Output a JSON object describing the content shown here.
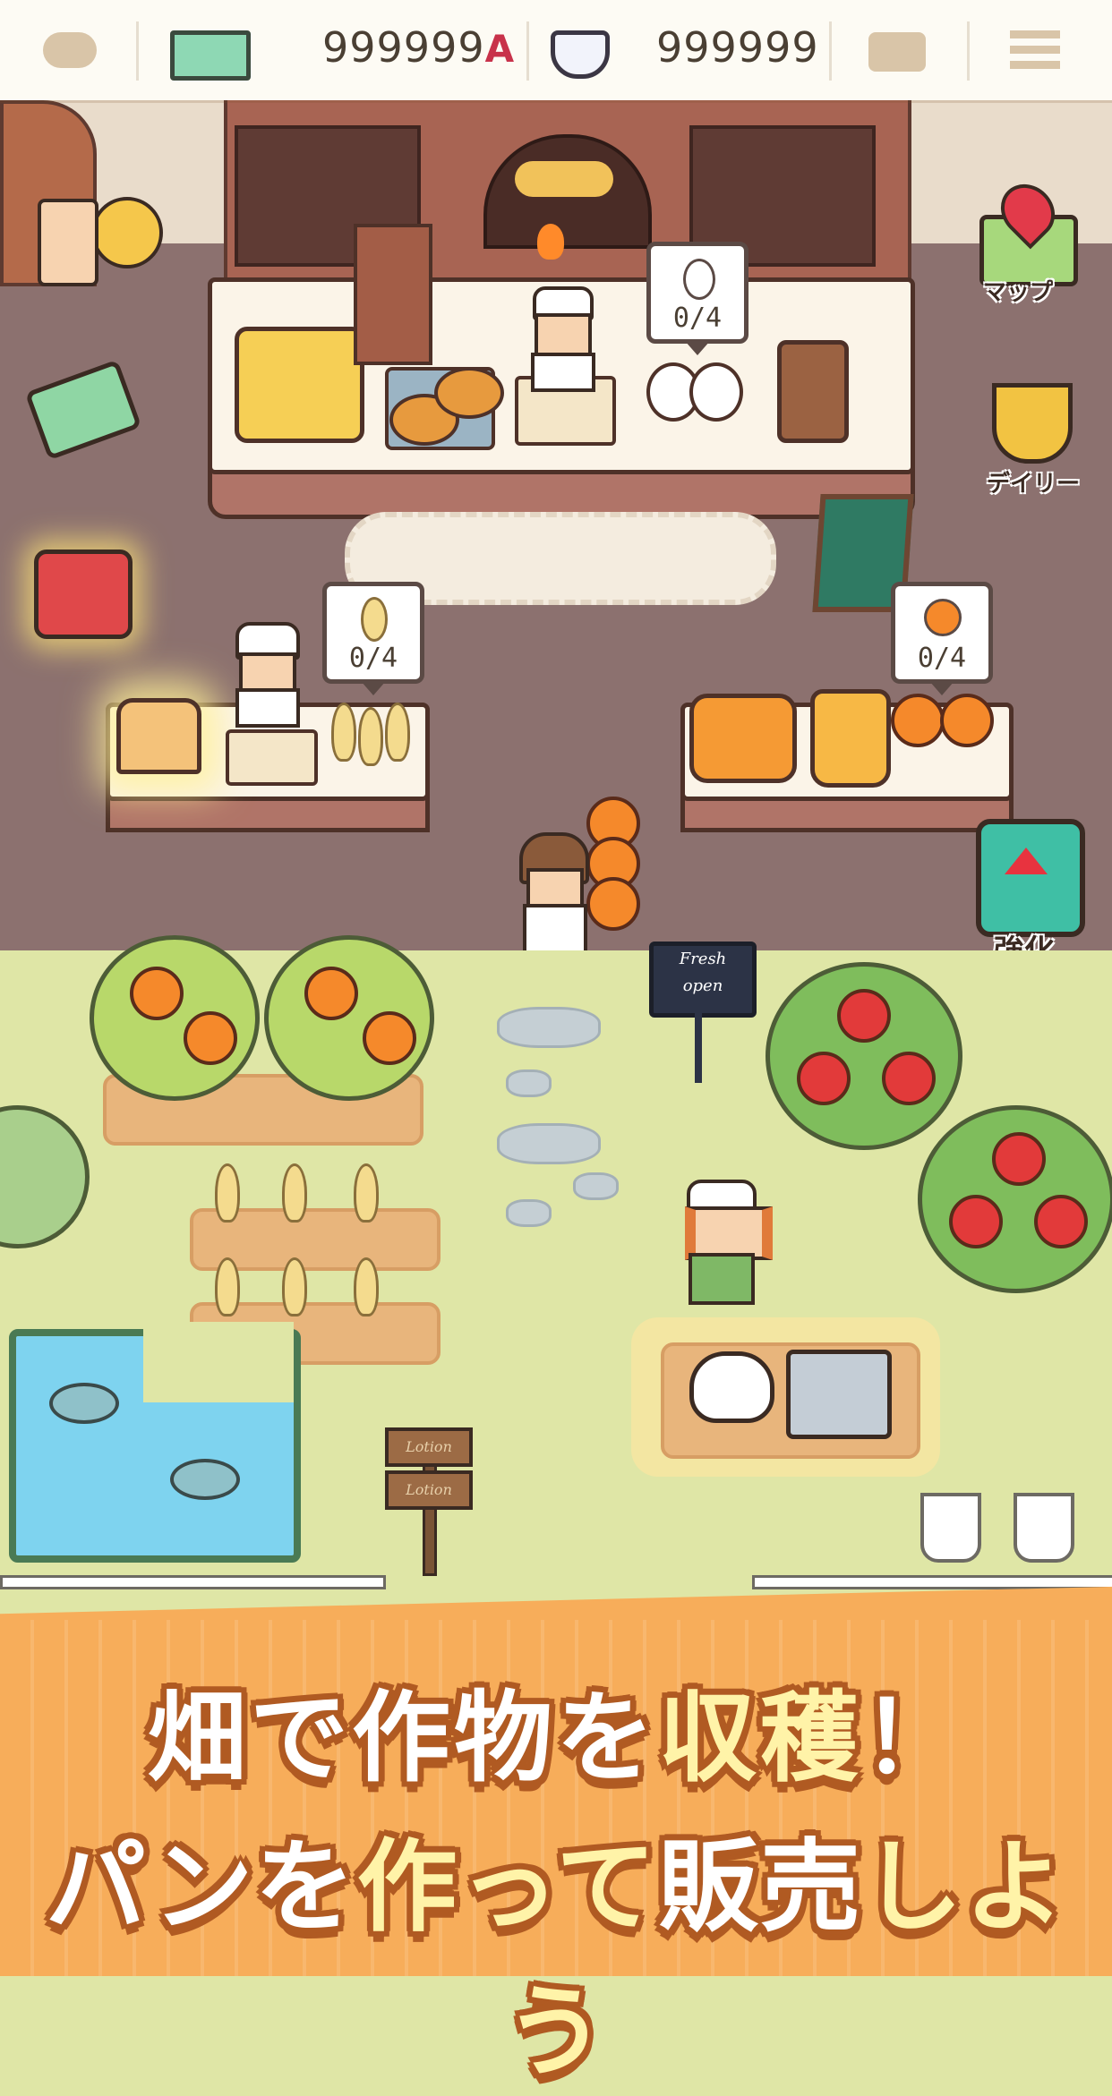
{
  "topbar": {
    "controller_icon": "gamepad-icon",
    "money_icon": "cash-icon",
    "money_value": "999999",
    "money_suffix": "A",
    "gem_icon": "diamond-icon",
    "gem_value": "999999",
    "camera_icon": "camera-icon",
    "menu_icon": "hamburger-menu-icon"
  },
  "side_buttons": {
    "map_label": "マップ",
    "daily_label": "デイリー",
    "upgrade_label": "強化"
  },
  "stations": {
    "egg_count": "0/4",
    "wheat_count": "0/4",
    "orange_count": "0/4"
  },
  "signs": {
    "shop_sign_line1": "Fresh",
    "shop_sign_line2": "open",
    "signpost_top": "Lotion",
    "signpost_bottom": "Lotion"
  },
  "banner": {
    "line1_a": "畑で作物を",
    "line1_b": "収穫",
    "line1_c": "！",
    "line2_a": "パンを",
    "line2_b": "作って",
    "line2_c": "販売",
    "line2_d": "しよう"
  },
  "colors": {
    "accent_orange": "#f7ad5a",
    "banner_outline": "#b05a22",
    "highlight_yellow": "#fff3a8",
    "floor": "#8c716f",
    "grass": "#dfe6a6"
  }
}
